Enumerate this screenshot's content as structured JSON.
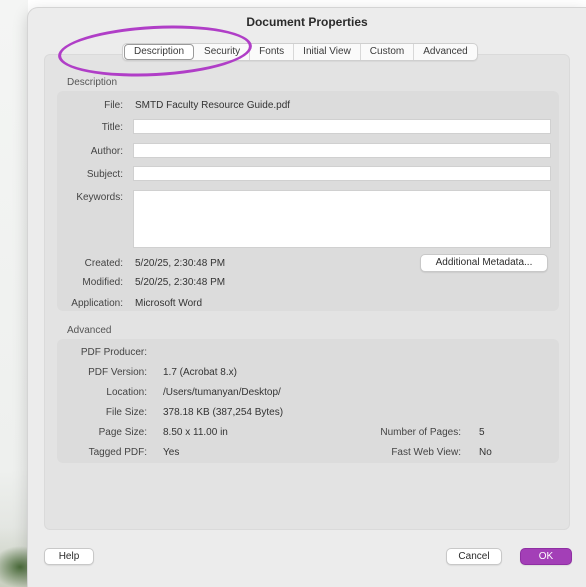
{
  "window": {
    "title": "Document Properties"
  },
  "tabs": [
    {
      "label": "Description"
    },
    {
      "label": "Security"
    },
    {
      "label": "Fonts"
    },
    {
      "label": "Initial View"
    },
    {
      "label": "Custom"
    },
    {
      "label": "Advanced"
    }
  ],
  "description": {
    "section_label": "Description",
    "file_label": "File:",
    "file_value": "SMTD Faculty Resource Guide.pdf",
    "title_label": "Title:",
    "title_value": "",
    "author_label": "Author:",
    "author_value": "",
    "subject_label": "Subject:",
    "subject_value": "",
    "keywords_label": "Keywords:",
    "keywords_value": "",
    "created_label": "Created:",
    "created_value": "5/20/25, 2:30:48 PM",
    "modified_label": "Modified:",
    "modified_value": "5/20/25, 2:30:48 PM",
    "application_label": "Application:",
    "application_value": "Microsoft Word",
    "metadata_button": "Additional Metadata..."
  },
  "advanced": {
    "section_label": "Advanced",
    "producer_label": "PDF Producer:",
    "producer_value": "",
    "version_label": "PDF Version:",
    "version_value": "1.7 (Acrobat 8.x)",
    "location_label": "Location:",
    "location_value": "/Users/tumanyan/Desktop/",
    "filesize_label": "File Size:",
    "filesize_value": "378.18 KB (387,254 Bytes)",
    "pagesize_label": "Page Size:",
    "pagesize_value": "8.50 x 11.00 in",
    "tagged_label": "Tagged PDF:",
    "tagged_value": "Yes",
    "pages_label": "Number of Pages:",
    "pages_value": "5",
    "fastweb_label": "Fast Web View:",
    "fastweb_value": "No"
  },
  "footer": {
    "help": "Help",
    "cancel": "Cancel",
    "ok": "OK"
  },
  "colors": {
    "annotation_ring": "#b03ec7",
    "ok_button": "#a33fb7"
  }
}
